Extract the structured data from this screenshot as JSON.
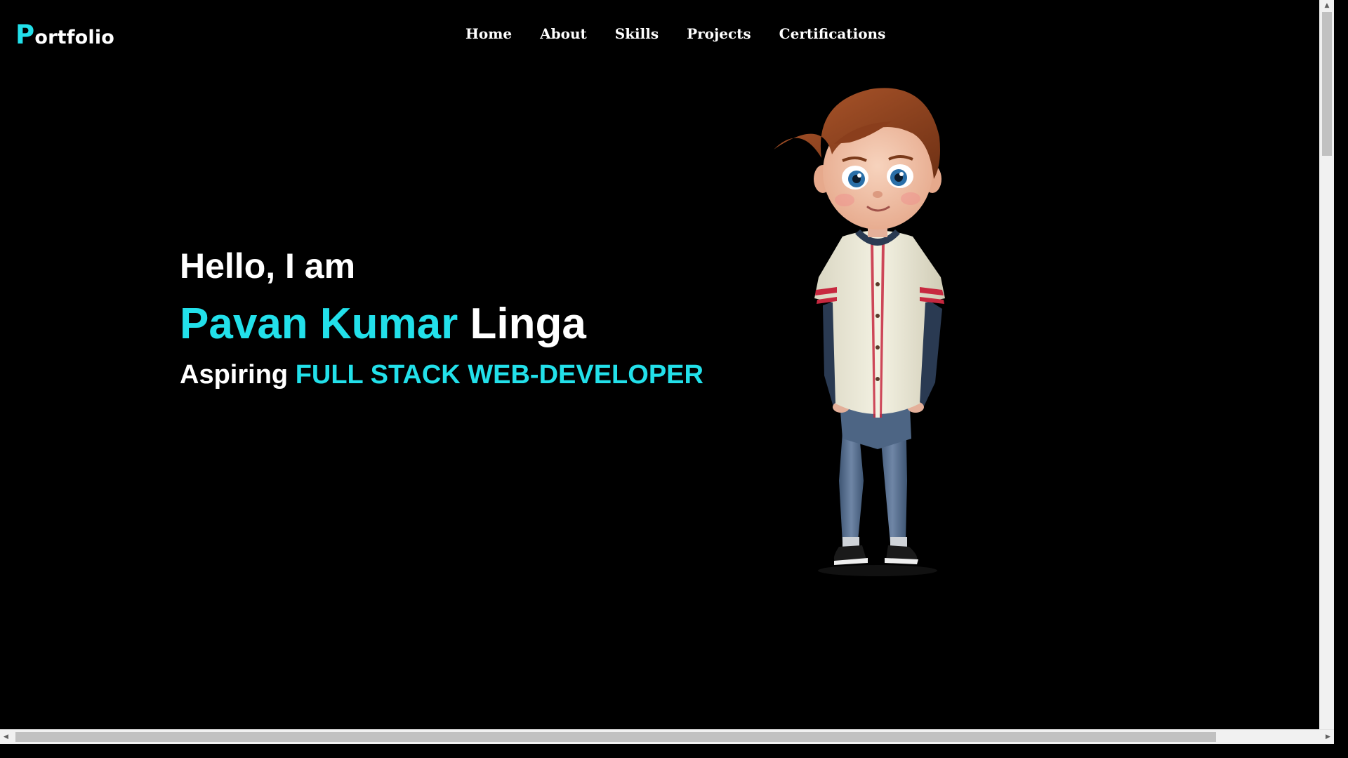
{
  "logo": {
    "first_letter": "P",
    "rest": "ortfolio"
  },
  "nav": {
    "items": [
      "Home",
      "About",
      "Skills",
      "Projects",
      "Certifications"
    ]
  },
  "hero": {
    "greeting": "Hello, I am",
    "name_first": "Pavan Kumar",
    "name_last": "Linga",
    "role_prefix": "Aspiring",
    "role_title": "FULL STACK WEB-DEVELOPER"
  },
  "illustration": {
    "icon": "cartoon-boy-character"
  },
  "colors": {
    "background": "#000000",
    "accent": "#22e0ea",
    "text": "#ffffff"
  },
  "scrollbars": {
    "up_glyph": "▲",
    "down_glyph": "▼",
    "left_glyph": "◀",
    "right_glyph": "▶"
  }
}
